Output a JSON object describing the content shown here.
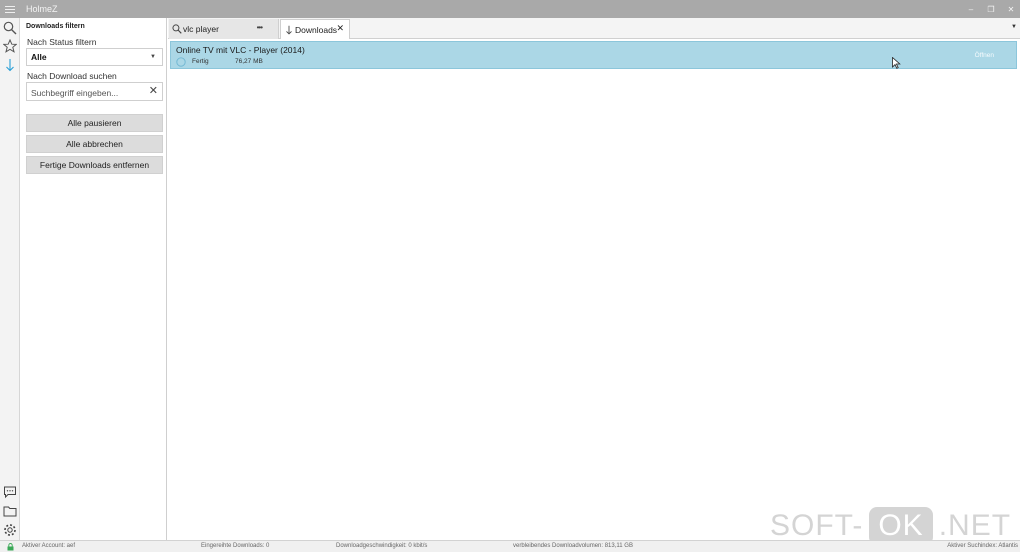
{
  "window": {
    "title": "HolmeZ",
    "controls": {
      "minimize": "–",
      "restore": "❐",
      "close": "✕"
    }
  },
  "rail": {
    "icons": [
      "search-icon",
      "star-icon",
      "download-arrow-icon",
      "chat-icon",
      "folder-icon",
      "gear-icon"
    ],
    "active": "download-arrow-icon",
    "accent": "#2a9fd6"
  },
  "filter_panel": {
    "title": "Downloads filtern",
    "status_label": "Nach Status filtern",
    "status_value": "Alle",
    "search_label": "Nach Download suchen",
    "search_placeholder": "Suchbegriff eingeben...",
    "clear_glyph": "✕",
    "buttons": {
      "pause_all": "Alle pausieren",
      "cancel_all": "Alle abbrechen",
      "remove_finished": "Fertige Downloads entfernen"
    }
  },
  "tabs": [
    {
      "label": "vlc player",
      "icon": "search-icon",
      "more": "•••",
      "active": false
    },
    {
      "label": "Downloads",
      "icon": "download-arrow-icon",
      "close": "✕",
      "active": true
    }
  ],
  "tab_overflow": "▼",
  "downloads": [
    {
      "title": "Online TV mit VLC - Player (2014)",
      "status": "Fertig",
      "size": "76,27 MB",
      "action": "Öffnen",
      "selected": true
    }
  ],
  "statusbar": {
    "account": "Aktiver Account: aef",
    "queued": "Eingereihte Downloads: 0",
    "speed": "Downloadgeschwindigkeit: 0 kbit/s",
    "remaining": "verbleibendes Downloadvolumen: 813,11 GB",
    "search_index": "Aktiver Suchindex: Atlantis"
  },
  "watermark": {
    "left": "SOFT-",
    "ok": "OK",
    "right": ".NET"
  },
  "colors": {
    "selection": "#abd7e6",
    "titlebar": "#a9a9a9",
    "button": "#dcdcdc"
  }
}
